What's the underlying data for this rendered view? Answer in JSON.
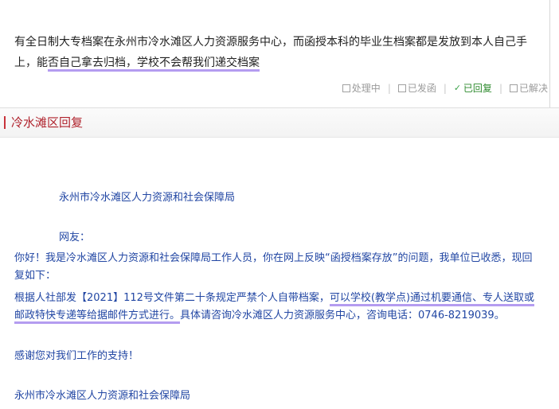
{
  "question": {
    "text_before": "有全日制大专档案在永州市冷水滩区人力资源服务中心，而函授本科的毕业生档案都是发放到本人自己手上，能",
    "text_marked": "否自己拿去归档，学校不会帮我们递交档案"
  },
  "status": {
    "items": [
      {
        "label": "处理中",
        "state": "unchecked"
      },
      {
        "label": "已发函",
        "state": "unchecked"
      },
      {
        "label": "已回复",
        "state": "checked"
      },
      {
        "label": "已解决",
        "state": "unchecked"
      }
    ],
    "separator": "|"
  },
  "section": {
    "title": "冷水滩区回复"
  },
  "reply": {
    "org_heading": "永州市冷水滩区人力资源和社会保障局",
    "salutation": "网友：",
    "greeting": "你好！我是冷水滩区人力资源和社会保障局工作人员，你在网上反映“函授档案存放”的问题，我单位已收悉，现回复如下：",
    "body_before": "根据人社部发【2021】112号文件第二十条规定严禁个人自带档案，",
    "body_marked": "可以学校(教学点)通过机要通信、专人送取或邮政特快专递等给据邮件方式进行。",
    "body_after": "具体请咨询冷水滩区人力资源服务中心，咨询电话：0746-8219039。",
    "thanks": "感谢您对我们工作的支持！",
    "signature": "永州市冷水滩区人力资源和社会保障局"
  },
  "colors": {
    "reply_text": "#2146a3",
    "section_title": "#b0232d",
    "highlight": "#b49cf0",
    "checked": "#3ba34a"
  }
}
